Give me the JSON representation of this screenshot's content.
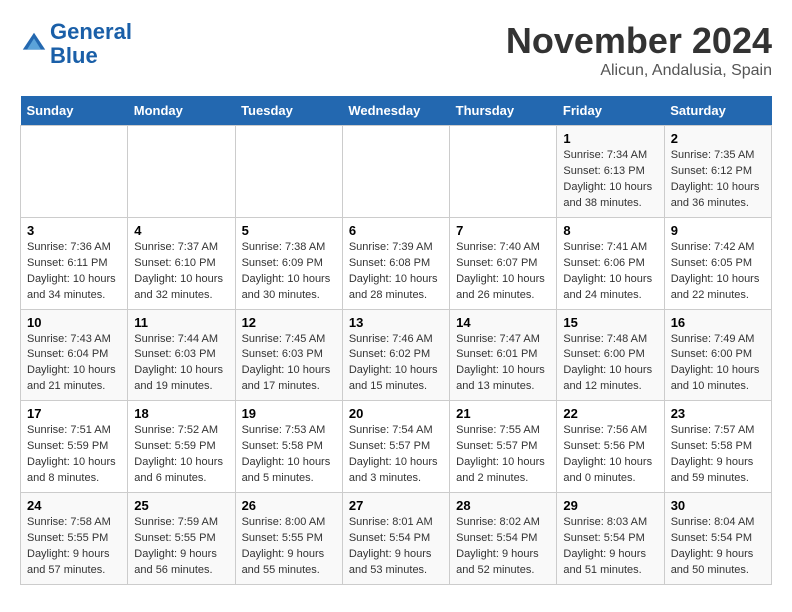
{
  "header": {
    "logo_line1": "General",
    "logo_line2": "Blue",
    "title": "November 2024",
    "location": "Alicun, Andalusia, Spain"
  },
  "weekdays": [
    "Sunday",
    "Monday",
    "Tuesday",
    "Wednesday",
    "Thursday",
    "Friday",
    "Saturday"
  ],
  "weeks": [
    [
      {
        "day": "",
        "info": ""
      },
      {
        "day": "",
        "info": ""
      },
      {
        "day": "",
        "info": ""
      },
      {
        "day": "",
        "info": ""
      },
      {
        "day": "",
        "info": ""
      },
      {
        "day": "1",
        "info": "Sunrise: 7:34 AM\nSunset: 6:13 PM\nDaylight: 10 hours\nand 38 minutes."
      },
      {
        "day": "2",
        "info": "Sunrise: 7:35 AM\nSunset: 6:12 PM\nDaylight: 10 hours\nand 36 minutes."
      }
    ],
    [
      {
        "day": "3",
        "info": "Sunrise: 7:36 AM\nSunset: 6:11 PM\nDaylight: 10 hours\nand 34 minutes."
      },
      {
        "day": "4",
        "info": "Sunrise: 7:37 AM\nSunset: 6:10 PM\nDaylight: 10 hours\nand 32 minutes."
      },
      {
        "day": "5",
        "info": "Sunrise: 7:38 AM\nSunset: 6:09 PM\nDaylight: 10 hours\nand 30 minutes."
      },
      {
        "day": "6",
        "info": "Sunrise: 7:39 AM\nSunset: 6:08 PM\nDaylight: 10 hours\nand 28 minutes."
      },
      {
        "day": "7",
        "info": "Sunrise: 7:40 AM\nSunset: 6:07 PM\nDaylight: 10 hours\nand 26 minutes."
      },
      {
        "day": "8",
        "info": "Sunrise: 7:41 AM\nSunset: 6:06 PM\nDaylight: 10 hours\nand 24 minutes."
      },
      {
        "day": "9",
        "info": "Sunrise: 7:42 AM\nSunset: 6:05 PM\nDaylight: 10 hours\nand 22 minutes."
      }
    ],
    [
      {
        "day": "10",
        "info": "Sunrise: 7:43 AM\nSunset: 6:04 PM\nDaylight: 10 hours\nand 21 minutes."
      },
      {
        "day": "11",
        "info": "Sunrise: 7:44 AM\nSunset: 6:03 PM\nDaylight: 10 hours\nand 19 minutes."
      },
      {
        "day": "12",
        "info": "Sunrise: 7:45 AM\nSunset: 6:03 PM\nDaylight: 10 hours\nand 17 minutes."
      },
      {
        "day": "13",
        "info": "Sunrise: 7:46 AM\nSunset: 6:02 PM\nDaylight: 10 hours\nand 15 minutes."
      },
      {
        "day": "14",
        "info": "Sunrise: 7:47 AM\nSunset: 6:01 PM\nDaylight: 10 hours\nand 13 minutes."
      },
      {
        "day": "15",
        "info": "Sunrise: 7:48 AM\nSunset: 6:00 PM\nDaylight: 10 hours\nand 12 minutes."
      },
      {
        "day": "16",
        "info": "Sunrise: 7:49 AM\nSunset: 6:00 PM\nDaylight: 10 hours\nand 10 minutes."
      }
    ],
    [
      {
        "day": "17",
        "info": "Sunrise: 7:51 AM\nSunset: 5:59 PM\nDaylight: 10 hours\nand 8 minutes."
      },
      {
        "day": "18",
        "info": "Sunrise: 7:52 AM\nSunset: 5:59 PM\nDaylight: 10 hours\nand 6 minutes."
      },
      {
        "day": "19",
        "info": "Sunrise: 7:53 AM\nSunset: 5:58 PM\nDaylight: 10 hours\nand 5 minutes."
      },
      {
        "day": "20",
        "info": "Sunrise: 7:54 AM\nSunset: 5:57 PM\nDaylight: 10 hours\nand 3 minutes."
      },
      {
        "day": "21",
        "info": "Sunrise: 7:55 AM\nSunset: 5:57 PM\nDaylight: 10 hours\nand 2 minutes."
      },
      {
        "day": "22",
        "info": "Sunrise: 7:56 AM\nSunset: 5:56 PM\nDaylight: 10 hours\nand 0 minutes."
      },
      {
        "day": "23",
        "info": "Sunrise: 7:57 AM\nSunset: 5:58 PM\nDaylight: 9 hours\nand 59 minutes."
      }
    ],
    [
      {
        "day": "24",
        "info": "Sunrise: 7:58 AM\nSunset: 5:55 PM\nDaylight: 9 hours\nand 57 minutes."
      },
      {
        "day": "25",
        "info": "Sunrise: 7:59 AM\nSunset: 5:55 PM\nDaylight: 9 hours\nand 56 minutes."
      },
      {
        "day": "26",
        "info": "Sunrise: 8:00 AM\nSunset: 5:55 PM\nDaylight: 9 hours\nand 55 minutes."
      },
      {
        "day": "27",
        "info": "Sunrise: 8:01 AM\nSunset: 5:54 PM\nDaylight: 9 hours\nand 53 minutes."
      },
      {
        "day": "28",
        "info": "Sunrise: 8:02 AM\nSunset: 5:54 PM\nDaylight: 9 hours\nand 52 minutes."
      },
      {
        "day": "29",
        "info": "Sunrise: 8:03 AM\nSunset: 5:54 PM\nDaylight: 9 hours\nand 51 minutes."
      },
      {
        "day": "30",
        "info": "Sunrise: 8:04 AM\nSunset: 5:54 PM\nDaylight: 9 hours\nand 50 minutes."
      }
    ]
  ]
}
